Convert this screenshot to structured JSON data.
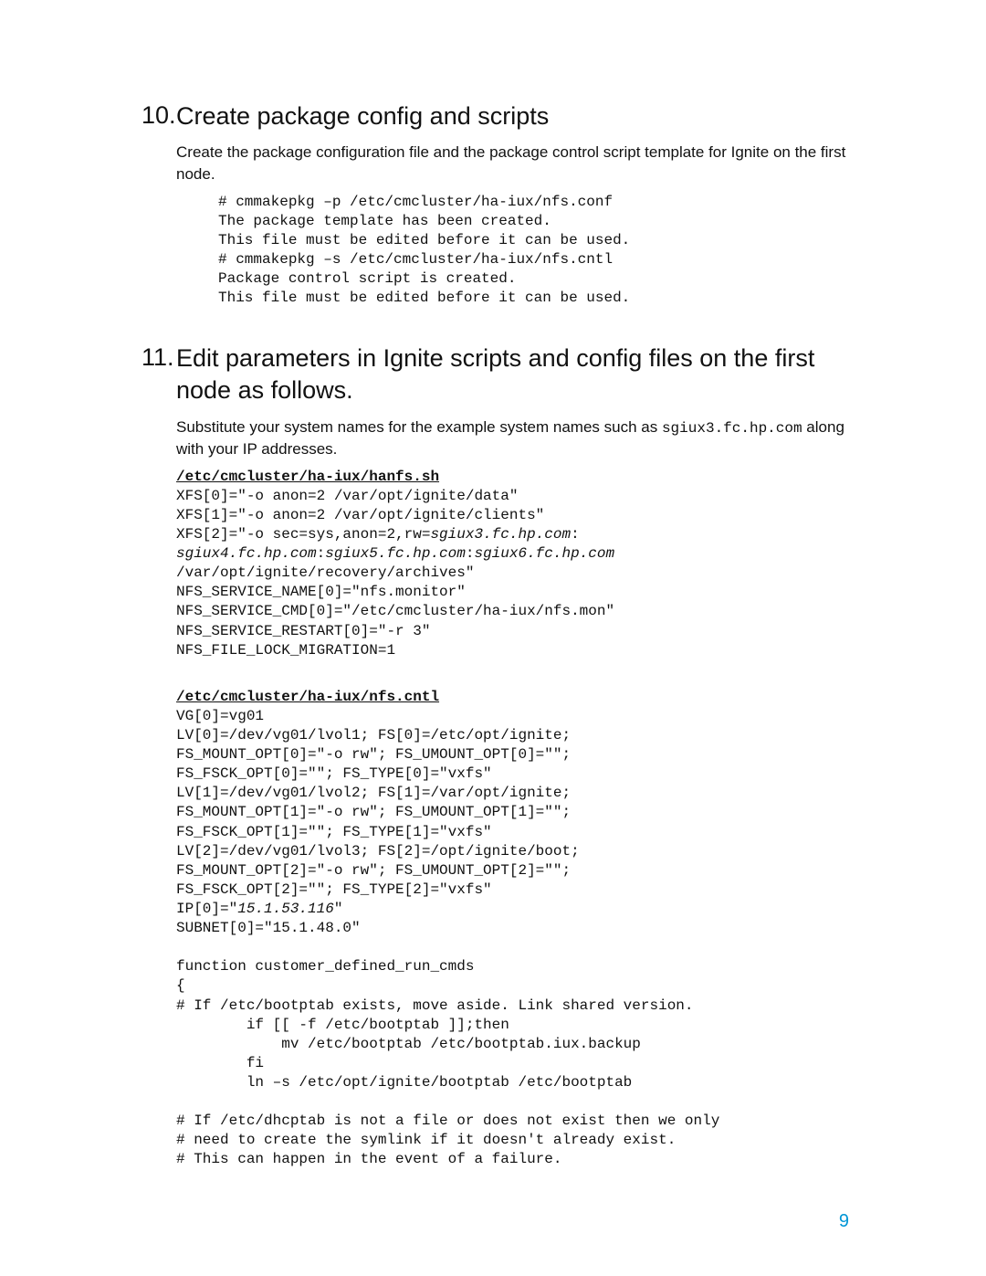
{
  "sections": [
    {
      "num": "10.",
      "heading": "Create package config and scripts",
      "para": "Create the package configuration file and the package control script template for Ignite on the first node.",
      "code1": "# cmmakepkg –p /etc/cmcluster/ha-iux/nfs.conf\nThe package template has been created.\nThis file must be edited before it can be used.\n# cmmakepkg –s /etc/cmcluster/ha-iux/nfs.cntl\nPackage control script is created.\nThis file must be edited before it can be used."
    },
    {
      "num": "11.",
      "heading": "Edit parameters in Ignite scripts and config files on the first node as follows.",
      "para_pre": "Substitute your system names for the example system names such as ",
      "para_mono": "sgiux3.fc.hp.com",
      "para_post": " along with your IP addresses.",
      "file1_name": "/etc/cmcluster/ha-iux/hanfs.sh",
      "file1_l1": "XFS[0]=\"-o anon=2 /var/opt/ignite/data\"",
      "file1_l2": "XFS[1]=\"-o anon=2 /var/opt/ignite/clients\"",
      "file1_l3a": "XFS[2]=\"-o sec=sys,anon=2,rw=",
      "file1_l3b": "sgiux3.fc.hp.com",
      "file1_l3c": ":",
      "file1_l4a": "sgiux4.fc.hp.com",
      "file1_l4b": ":",
      "file1_l4c": "sgiux5.fc.hp.com",
      "file1_l4d": ":",
      "file1_l4e": "sgiux6.fc.hp.com",
      "file1_l5": "/var/opt/ignite/recovery/archives\"",
      "file1_l6": "NFS_SERVICE_NAME[0]=\"nfs.monitor\"",
      "file1_l7": "NFS_SERVICE_CMD[0]=\"/etc/cmcluster/ha-iux/nfs.mon\"",
      "file1_l8": "NFS_SERVICE_RESTART[0]=\"-r 3\"",
      "file1_l9": "NFS_FILE_LOCK_MIGRATION=1",
      "file2_name": "/etc/cmcluster/ha-iux/nfs.cntl",
      "file2_l1": "VG[0]=vg01",
      "file2_l2": "LV[0]=/dev/vg01/lvol1; FS[0]=/etc/opt/ignite;",
      "file2_l3": "FS_MOUNT_OPT[0]=\"-o rw\"; FS_UMOUNT_OPT[0]=\"\";",
      "file2_l4": "FS_FSCK_OPT[0]=\"\"; FS_TYPE[0]=\"vxfs\"",
      "file2_l5": "LV[1]=/dev/vg01/lvol2; FS[1]=/var/opt/ignite;",
      "file2_l6": "FS_MOUNT_OPT[1]=\"-o rw\"; FS_UMOUNT_OPT[1]=\"\";",
      "file2_l7": "FS_FSCK_OPT[1]=\"\"; FS_TYPE[1]=\"vxfs\"",
      "file2_l8": "LV[2]=/dev/vg01/lvol3; FS[2]=/opt/ignite/boot;",
      "file2_l9": "FS_MOUNT_OPT[2]=\"-o rw\"; FS_UMOUNT_OPT[2]=\"\";",
      "file2_l10": "FS_FSCK_OPT[2]=\"\"; FS_TYPE[2]=\"vxfs\"",
      "file2_l11a": "IP[0]=\"",
      "file2_l11b": "15.1.53.116",
      "file2_l11c": "\"",
      "file2_l12": "SUBNET[0]=\"15.1.48.0\"",
      "file2_l13": "",
      "file2_l14": "function customer_defined_run_cmds",
      "file2_l15": "{",
      "file2_l16": "# If /etc/bootptab exists, move aside. Link shared version.",
      "file2_l17": "        if [[ -f /etc/bootptab ]];then",
      "file2_l18": "            mv /etc/bootptab /etc/bootptab.iux.backup",
      "file2_l19": "        fi",
      "file2_l20": "        ln –s /etc/opt/ignite/bootptab /etc/bootptab",
      "file2_l21": "",
      "file2_l22": "# If /etc/dhcptab is not a file or does not exist then we only",
      "file2_l23": "# need to create the symlink if it doesn't already exist.",
      "file2_l24": "# This can happen in the event of a failure."
    }
  ],
  "pageNumber": "9"
}
